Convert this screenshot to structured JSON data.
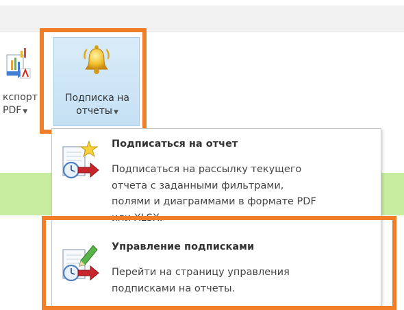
{
  "ribbon": {
    "export_button": {
      "line1": "кспорт",
      "line2": "PDF",
      "icon": "export-pdf-icon"
    },
    "subscribe_button": {
      "line1": "Подписка на",
      "line2": "отчеты",
      "icon": "bell-icon"
    }
  },
  "dropdown": {
    "items": [
      {
        "title": "Подписаться на отчет",
        "desc_lines": [
          "Подписаться на рассылку текущего",
          "отчета с заданными фильтрами,",
          "полями и диаграммами в формате PDF",
          "или XLSX."
        ],
        "icon": "report-star-clock-icon"
      },
      {
        "title": "Управление подписками",
        "desc_lines": [
          "Перейти на страницу управления",
          "подписками на отчеты."
        ],
        "icon": "report-pencil-clock-icon"
      }
    ]
  },
  "colors": {
    "highlight": "#f07d27",
    "selected_button_bg": "#c5e0f4",
    "green_band": "#c8eca0"
  }
}
